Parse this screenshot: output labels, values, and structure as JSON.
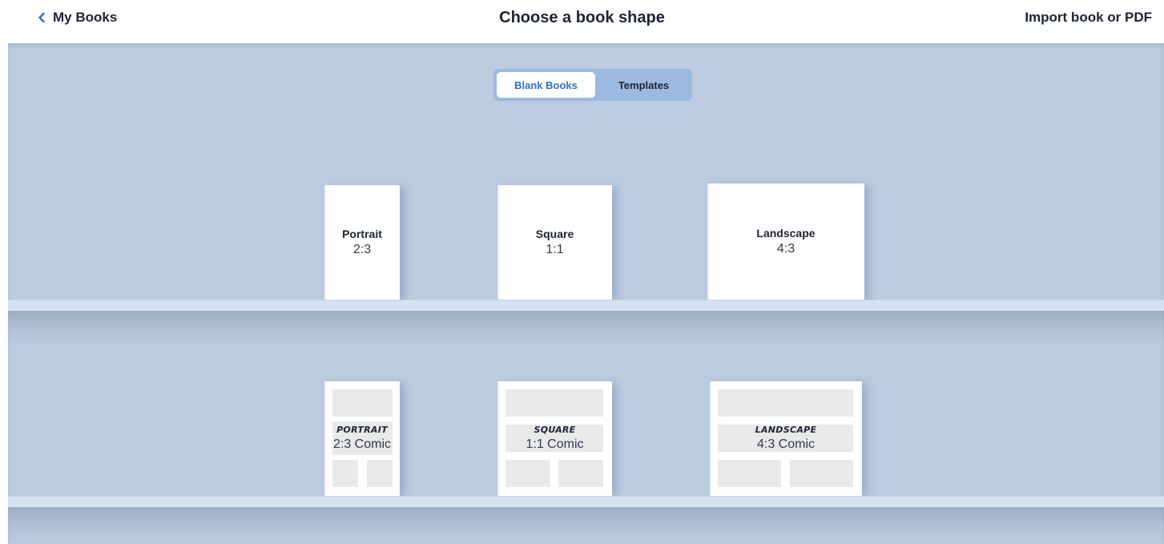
{
  "header": {
    "back_label": "My Books",
    "title": "Choose a book shape",
    "import_label": "Import book or PDF"
  },
  "tabs": [
    {
      "label": "Blank Books",
      "selected": true
    },
    {
      "label": "Templates",
      "selected": false
    }
  ],
  "shelves": {
    "blank": [
      {
        "name": "Portrait",
        "ratio": "2:3"
      },
      {
        "name": "Square",
        "ratio": "1:1"
      },
      {
        "name": "Landscape",
        "ratio": "4:3"
      }
    ],
    "comic": [
      {
        "name": "PORTRAIT",
        "ratio": "2:3 Comic"
      },
      {
        "name": "SQUARE",
        "ratio": "1:1 Comic"
      },
      {
        "name": "LANDSCAPE",
        "ratio": "4:3 Comic"
      }
    ]
  },
  "colors": {
    "accent": "#2f6fd0",
    "stage_bg": "#bccce0",
    "segment_bg": "#9cb9e0",
    "shelf": "#d4e2f3"
  },
  "icons": {
    "back": "chevron-left-icon"
  }
}
